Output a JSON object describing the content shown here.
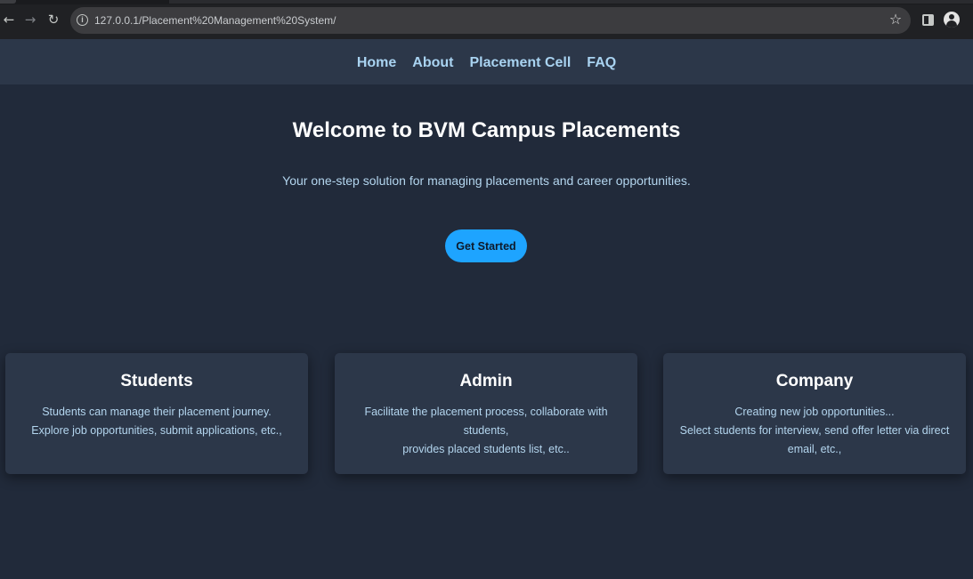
{
  "browser": {
    "url": "127.0.0.1/Placement%20Management%20System/",
    "back_icon": "←",
    "forward_icon": "→",
    "reload_icon": "↻",
    "info_icon": "i",
    "star_icon": "☆"
  },
  "nav": {
    "items": [
      "Home",
      "About",
      "Placement Cell",
      "FAQ"
    ]
  },
  "hero": {
    "title": "Welcome to BVM Campus Placements",
    "subtitle": "Your one-step solution for managing placements and career opportunities.",
    "cta_label": "Get Started"
  },
  "cards": [
    {
      "title": "Students",
      "lines": [
        "Students can manage their placement journey.",
        "Explore job opportunities, submit applications, etc.,"
      ]
    },
    {
      "title": "Admin",
      "lines": [
        "Facilitate the placement process, collaborate with students,",
        "provides placed students list, etc.."
      ]
    },
    {
      "title": "Company",
      "lines": [
        "Creating new job opportunities...",
        "Select students for interview, send offer letter via direct email, etc.,"
      ]
    }
  ],
  "colors": {
    "background": "#212a3a",
    "nav_background": "#2c3749",
    "nav_link": "#a9d3f1",
    "accent_button": "#1ea4ff"
  }
}
